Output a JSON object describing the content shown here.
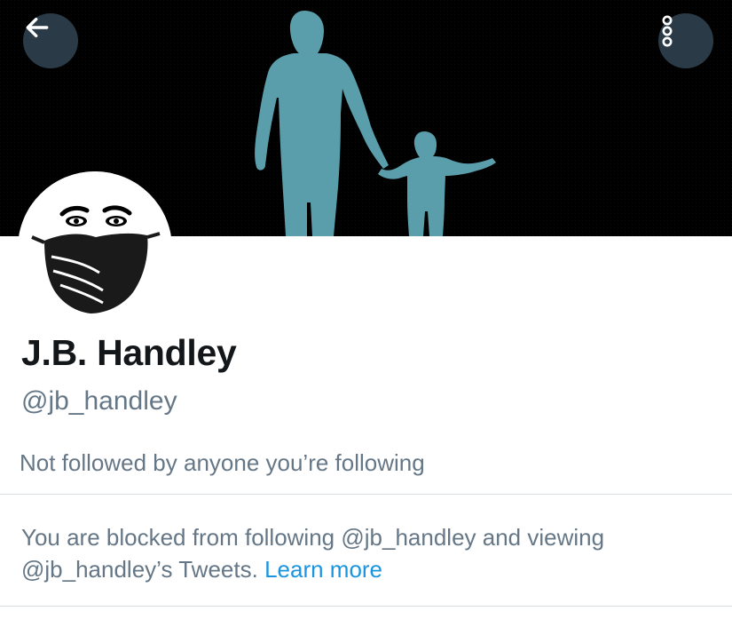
{
  "header": {
    "back_icon": "arrow-left-icon",
    "more_icon": "more-vertical-icon",
    "button_bg": "#2a3b47"
  },
  "banner": {
    "background": "#000000",
    "silhouette_color": "#5a9eab",
    "subject": "silhouette of adult holding child's hand"
  },
  "profile": {
    "avatar_subject": "face wearing black mask",
    "display_name": "J.B. Handley",
    "handle": "@jb_handley",
    "followed_by_text": "Not followed by anyone you’re following"
  },
  "blocked_notice": {
    "text": "You are blocked from following @jb_handley and viewing @jb_handley’s Tweets.",
    "link_label": "Learn more",
    "link_color": "#1b95e0"
  },
  "colors": {
    "primary_text": "#14171a",
    "secondary_text": "#657786",
    "divider": "#d9dee2"
  }
}
